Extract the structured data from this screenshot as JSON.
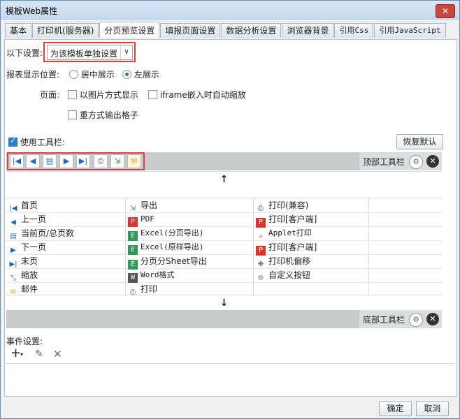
{
  "window": {
    "title": "模板Web属性",
    "close_glyph": "✕"
  },
  "tabs": [
    {
      "label": "基本"
    },
    {
      "label": "打印机(服务器)"
    },
    {
      "label": "分页预览设置"
    },
    {
      "label": "填报页面设置"
    },
    {
      "label": "数据分析设置"
    },
    {
      "label": "浏览器背景"
    },
    {
      "label": "引用Css"
    },
    {
      "label": "引用JavaScript"
    }
  ],
  "settings": {
    "mode_label": "以下设置:",
    "mode_value": "为该模板单独设置",
    "position_label": "报表显示位置:",
    "position_options": [
      "居中展示",
      "左展示"
    ],
    "position_selected": "左展示",
    "page_label": "页面:",
    "page_options": [
      {
        "label": "以图片方式显示",
        "checked": false
      },
      {
        "label": "iframe嵌入时自动缩放",
        "checked": false
      },
      {
        "label": "重方式输出格子",
        "checked": false
      }
    ]
  },
  "toolbar": {
    "use_toolbar_label": "使用工具栏:",
    "use_toolbar_checked": true,
    "reset_label": "恢复默认",
    "top_label": "顶部工具栏",
    "bottom_label": "底部工具栏",
    "up_arrow": "↑",
    "down_arrow": "↓",
    "top_icons": [
      "first-page",
      "previous-page",
      "current-page",
      "next-page",
      "last-page",
      "print",
      "export",
      "email"
    ]
  },
  "items": {
    "col1": [
      "首页",
      "上一页",
      "当前页/总页数",
      "下一页",
      "末页",
      "缩放",
      "邮件"
    ],
    "col2": [
      "导出",
      "PDF",
      "Excel(分页导出)",
      "Excel(原样导出)",
      "分页分Sheet导出",
      "Word格式",
      "打印"
    ],
    "col3": [
      "打印(兼容)",
      "打印[客户端]",
      "Applet打印",
      "打印[客户端]",
      "打印机偏移",
      "自定义按钮"
    ]
  },
  "events": {
    "label": "事件设置:"
  },
  "footer": {
    "ok_label": "确定",
    "cancel_label": "取消"
  },
  "colors": {
    "highlight_red": "#e0403a",
    "accent_blue": "#2a6bc2",
    "toolbar_band": "#c8cacc"
  }
}
